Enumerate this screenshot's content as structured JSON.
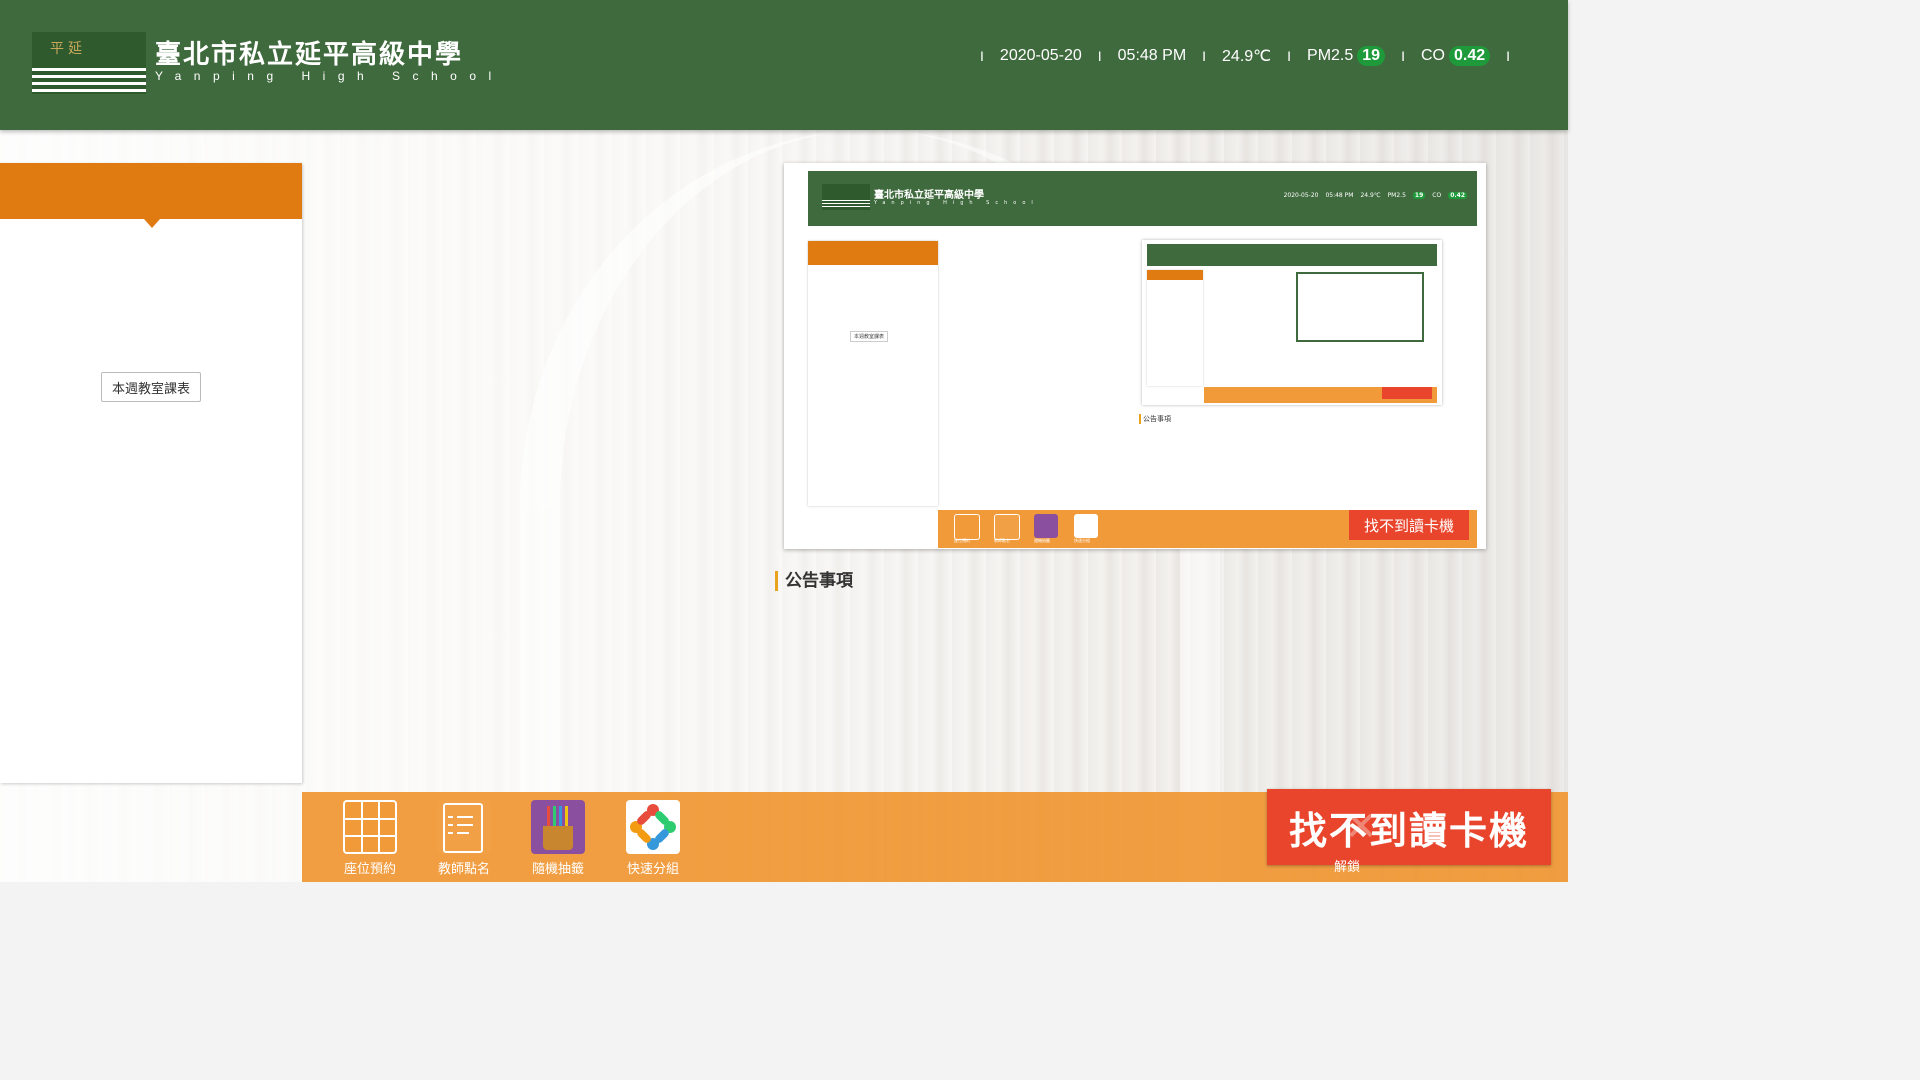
{
  "header": {
    "school_name": "臺北市私立延平高級中學",
    "school_name_en": "Yanping High School",
    "logo_text": "平延",
    "date": "2020-05-20",
    "time": "05:48 PM",
    "temperature": "24.9℃",
    "pm25_label": "PM2.5",
    "pm25_value": "19",
    "co_label": "CO",
    "co_value": "0.42",
    "separator": "I"
  },
  "left_panel": {
    "schedule_button": "本週教室課表"
  },
  "preview": {
    "school_name": "臺北市私立延平高級中學",
    "school_name_en": "Yanping High School",
    "date": "2020-05-20",
    "time": "05:48 PM",
    "temperature": "24.9℃",
    "pm25_label": "PM2.5",
    "pm25_value": "19",
    "co_label": "CO",
    "co_value": "0.42",
    "schedule_button": "本週教室課表",
    "notice_title": "公告事項",
    "no_card": "找不到讀卡機",
    "tools": [
      "座位預約",
      "教師點名",
      "隨機抽籤",
      "快速分組"
    ]
  },
  "notice": {
    "title": "公告事項"
  },
  "toolbar": {
    "tools": [
      {
        "label": "座位預約",
        "icon": "seat-grid-icon"
      },
      {
        "label": "教師點名",
        "icon": "roll-call-form-icon"
      },
      {
        "label": "隨機抽籤",
        "icon": "lottery-sticks-icon"
      },
      {
        "label": "快速分組",
        "icon": "group-people-icon"
      }
    ]
  },
  "card_reader": {
    "message": "找不到讀卡機",
    "unlock_label": "解鎖"
  },
  "colors": {
    "header_green": "#3f6a3d",
    "accent_orange": "#e07b12",
    "toolbar_orange": "#f19a3a",
    "alert_red": "#e8452c",
    "badge_green": "#1f9a3a"
  }
}
